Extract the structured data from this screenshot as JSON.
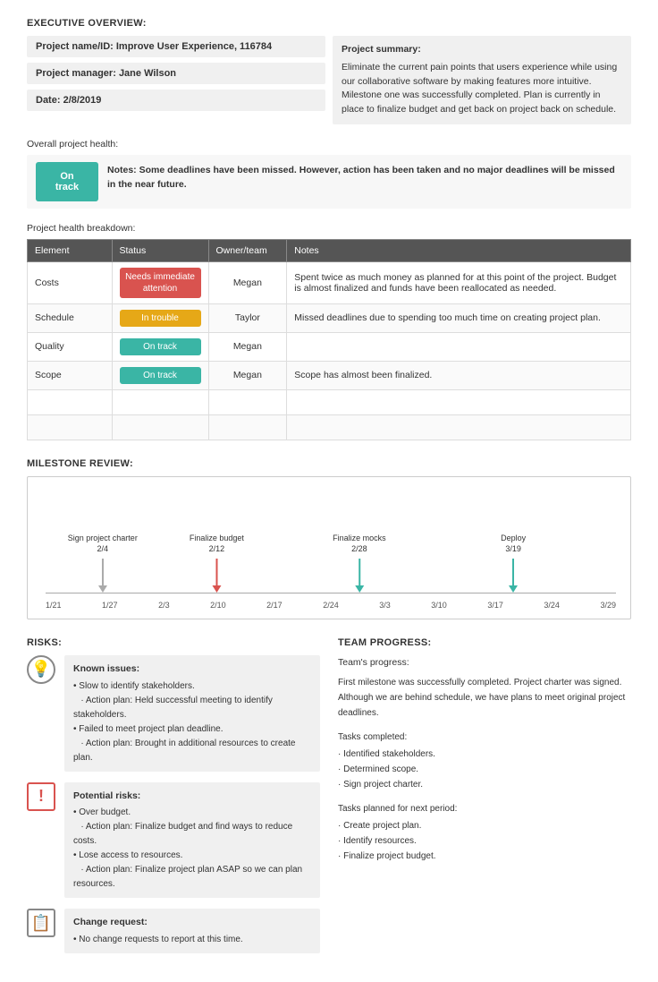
{
  "execOverview": {
    "sectionTitle": "EXECUTIVE OVERVIEW:",
    "projectName": {
      "label": "Project name/ID:",
      "value": "Improve User Experience, 116784"
    },
    "projectManager": {
      "label": "Project manager:",
      "value": "Jane Wilson"
    },
    "date": {
      "label": "Date:",
      "value": "2/8/2019"
    },
    "summary": {
      "title": "Project summary:",
      "text": "Eliminate the current pain points that users experience while using our collaborative software by making features more intuitive. Milestone one was successfully completed. Plan is currently in place to finalize budget and get back on project back on schedule."
    }
  },
  "projectHealth": {
    "label": "Overall project health:",
    "badge": "On track",
    "notesLabel": "Notes:",
    "notesText": "Some deadlines have been missed. However, action has been taken and no major deadlines will be missed in the near future."
  },
  "breakdown": {
    "label": "Project health breakdown:",
    "headers": [
      "Element",
      "Status",
      "Owner/team",
      "Notes"
    ],
    "rows": [
      {
        "element": "Costs",
        "status": "needs",
        "statusText": "Needs immediate attention",
        "owner": "Megan",
        "notes": "Spent twice as much money as planned for at this point of the project. Budget is almost finalized and funds have been reallocated as needed."
      },
      {
        "element": "Schedule",
        "status": "trouble",
        "statusText": "In trouble",
        "owner": "Taylor",
        "notes": "Missed deadlines due to spending too much time on creating project plan."
      },
      {
        "element": "Quality",
        "status": "ontrack",
        "statusText": "On track",
        "owner": "Megan",
        "notes": ""
      },
      {
        "element": "Scope",
        "status": "ontrack",
        "statusText": "On track",
        "owner": "Megan",
        "notes": "Scope has almost been finalized."
      }
    ]
  },
  "milestone": {
    "sectionTitle": "MILESTONE REVIEW:",
    "markers": [
      {
        "label": "Sign project charter\n2/4",
        "position": 0.1,
        "color": "gray"
      },
      {
        "label": "Finalize budget\n2/12",
        "position": 0.3,
        "color": "red"
      },
      {
        "label": "Finalize mocks\n2/28",
        "position": 0.55,
        "color": "teal"
      },
      {
        "label": "Deploy\n3/19",
        "position": 0.82,
        "color": "teal"
      }
    ],
    "axisLabels": [
      "1/21",
      "1/27",
      "2/3",
      "2/10",
      "2/17",
      "2/24",
      "3/3",
      "3/10",
      "3/17",
      "3/24",
      "3/29"
    ]
  },
  "risks": {
    "sectionTitle": "RISKS:",
    "items": [
      {
        "iconType": "bulb",
        "iconChar": "💡",
        "title": "Known issues:",
        "lines": [
          "• Slow to identify stakeholders.",
          "    · Action plan: Held successful meeting to identify stakeholders.",
          "• Failed to meet project plan deadline.",
          "    · Action plan: Brought in additional resources to create plan."
        ]
      },
      {
        "iconType": "exclamation",
        "iconChar": "!",
        "title": "Potential risks:",
        "lines": [
          "• Over budget.",
          "    · Action plan: Finalize budget and find ways to reduce costs.",
          "• Lose access to resources.",
          "    · Action plan: Finalize project plan ASAP so we can plan resources."
        ]
      },
      {
        "iconType": "clipboard",
        "iconChar": "📋",
        "title": "Change request:",
        "lines": [
          "• No change requests to report at this time."
        ]
      }
    ]
  },
  "teamProgress": {
    "sectionTitle": "TEAM PROGRESS:",
    "teamsProgressTitle": "Team's progress:",
    "teamsProgressText": "First milestone was successfully completed. Project charter was signed. Although we are behind schedule, we have plans to meet original project deadlines.",
    "tasksCompleted": {
      "title": "Tasks completed:",
      "items": [
        "· Identified stakeholders.",
        "· Determined scope.",
        "· Sign project charter."
      ]
    },
    "tasksPlanned": {
      "title": "Tasks planned for next period:",
      "items": [
        "· Create project plan.",
        "· Identify resources.",
        "· Finalize project budget."
      ]
    }
  }
}
